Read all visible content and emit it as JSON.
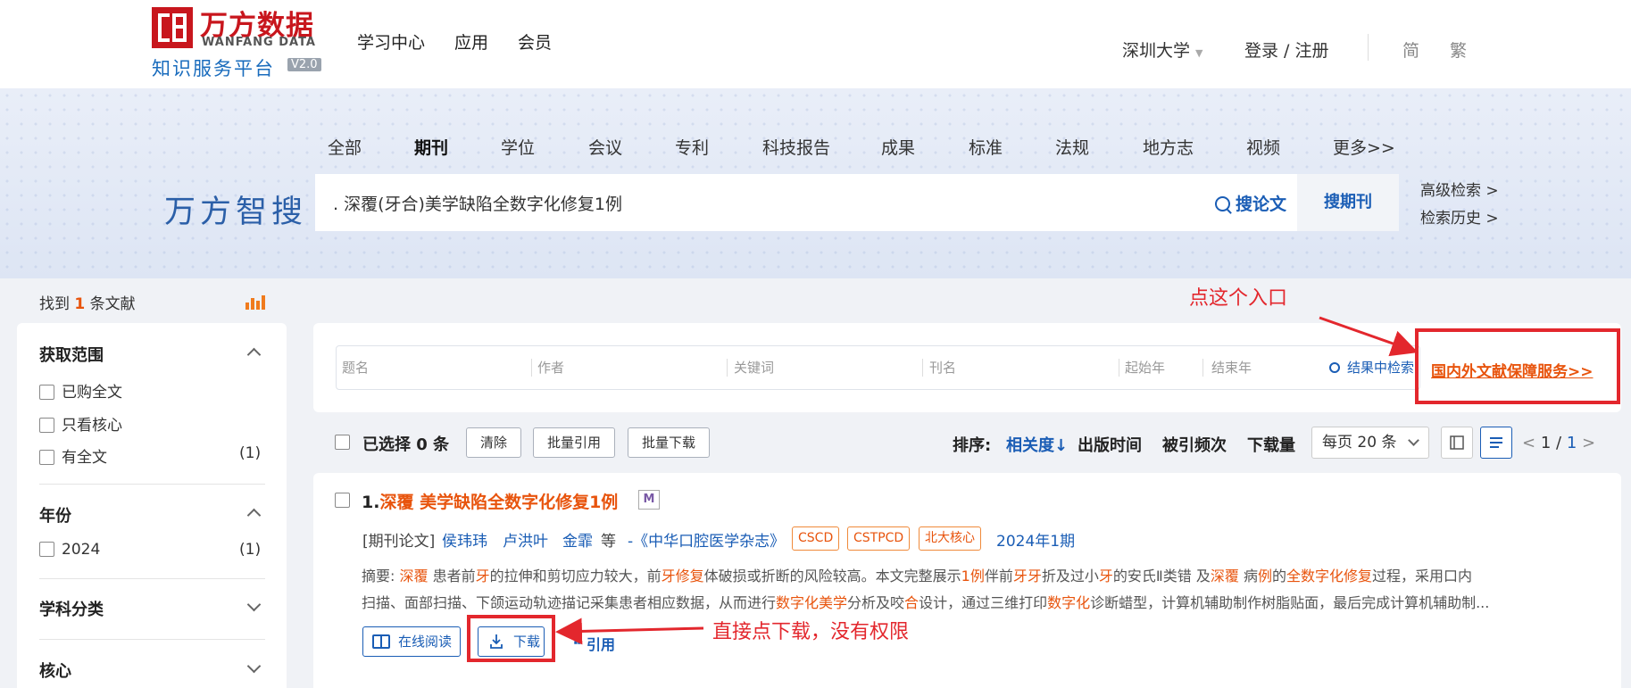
{
  "header": {
    "logo_cn": "万方数据",
    "logo_en": "WANFANG DATA",
    "logo_sub": "知识服务平台",
    "logo_version": "V2.0",
    "nav": [
      "学习中心",
      "应用",
      "会员"
    ],
    "institution": "深圳大学",
    "login": "登录 / 注册",
    "lang_simplified": "简",
    "lang_traditional": "繁"
  },
  "search": {
    "brand": "万方智搜",
    "tabs": [
      "全部",
      "期刊",
      "学位",
      "会议",
      "专利",
      "科技报告",
      "成果",
      "标准",
      "法规",
      "地方志",
      "视频",
      "更多>>"
    ],
    "active_tab": "期刊",
    "query": ". 深覆(牙合)美学缺陷全数字化修复1例",
    "search_papers": "搜论文",
    "search_journal": "搜期刊",
    "advanced": "高级检索 >",
    "history": "检索历史 >"
  },
  "sidebar": {
    "found_prefix": "找到",
    "found_count": "1",
    "found_suffix": "条文献",
    "sections": {
      "scope": {
        "title": "获取范围",
        "options": [
          {
            "label": "已购全文",
            "count": ""
          },
          {
            "label": "只看核心",
            "count": ""
          },
          {
            "label": "有全文",
            "count": "(1)"
          }
        ]
      },
      "year": {
        "title": "年份",
        "options": [
          {
            "label": "2024",
            "count": "(1)"
          }
        ]
      },
      "subject": {
        "title": "学科分类"
      },
      "core": {
        "title": "核心"
      }
    }
  },
  "filters": {
    "title": "题名",
    "author": "作者",
    "keyword": "关键词",
    "journal": "刊名",
    "start_year": "起始年",
    "end_year": "结束年",
    "search_in_results": "结果中检索",
    "service_link": "国内外文献保障服务>>"
  },
  "toolbar": {
    "selected": "已选择 0 条",
    "clear": "清除",
    "batch_cite": "批量引用",
    "batch_download": "批量下载",
    "sort_label": "排序:",
    "sort_options": [
      "相关度↓",
      "出版时间",
      "被引频次",
      "下载量"
    ],
    "per_page": "每页 20 条",
    "page_prev": "<",
    "page_current": "1",
    "page_sep": "/",
    "page_total": "1",
    "page_next": ">"
  },
  "result": {
    "number": "1.",
    "title": "深覆 美学缺陷全数字化修复1例",
    "badge": "M",
    "type": "[期刊论文]",
    "authors": [
      "侯玮玮",
      "卢洪叶",
      "金霏"
    ],
    "etc": "等",
    "journal": "-《中华口腔医学杂志》",
    "tags": [
      "CSCD",
      "CSTPCD",
      "北大核心"
    ],
    "issue": "2024年1期",
    "abstract_line1": [
      {
        "t": "摘要: ",
        "hl": false
      },
      {
        "t": "深覆",
        "hl": true
      },
      {
        "t": " 患者前",
        "hl": false
      },
      {
        "t": "牙",
        "hl": true
      },
      {
        "t": "的拉伸和剪切应力较大，前",
        "hl": false
      },
      {
        "t": "牙修复",
        "hl": true
      },
      {
        "t": "体破损或折断的风险较高。本文完整展示",
        "hl": false
      },
      {
        "t": "1例",
        "hl": true
      },
      {
        "t": "伴前",
        "hl": false
      },
      {
        "t": "牙牙",
        "hl": true
      },
      {
        "t": "折及过小",
        "hl": false
      },
      {
        "t": "牙",
        "hl": true
      },
      {
        "t": "的安氏Ⅱ类错 及",
        "hl": false
      },
      {
        "t": "深覆",
        "hl": true
      },
      {
        "t": " 病",
        "hl": false
      },
      {
        "t": "例",
        "hl": true
      },
      {
        "t": "的",
        "hl": false
      },
      {
        "t": "全数字化修复",
        "hl": true
      },
      {
        "t": "过程，采用口内",
        "hl": false
      }
    ],
    "abstract_line2": [
      {
        "t": "扫描、面部扫描、下颌运动轨迹描记采集患者相应数据，从而进行",
        "hl": false
      },
      {
        "t": "数字化美学",
        "hl": true
      },
      {
        "t": "分析及咬",
        "hl": false
      },
      {
        "t": "合",
        "hl": true
      },
      {
        "t": "设计，通过三维打印",
        "hl": false
      },
      {
        "t": "数字化",
        "hl": true
      },
      {
        "t": "诊断蜡型，计算机辅助制作树脂贴面，最后完成计算机辅助制...",
        "hl": false
      }
    ],
    "read_online": "在线阅读",
    "download": "下载",
    "cite": "引用"
  },
  "annotations": {
    "entry_note": "点这个入口",
    "download_note": "直接点下载，没有权限"
  },
  "colors": {
    "brand_red": "#c8161d",
    "link_blue": "#1a5db5",
    "highlight_orange": "#e8540d",
    "annotation_red": "#e3272d"
  }
}
